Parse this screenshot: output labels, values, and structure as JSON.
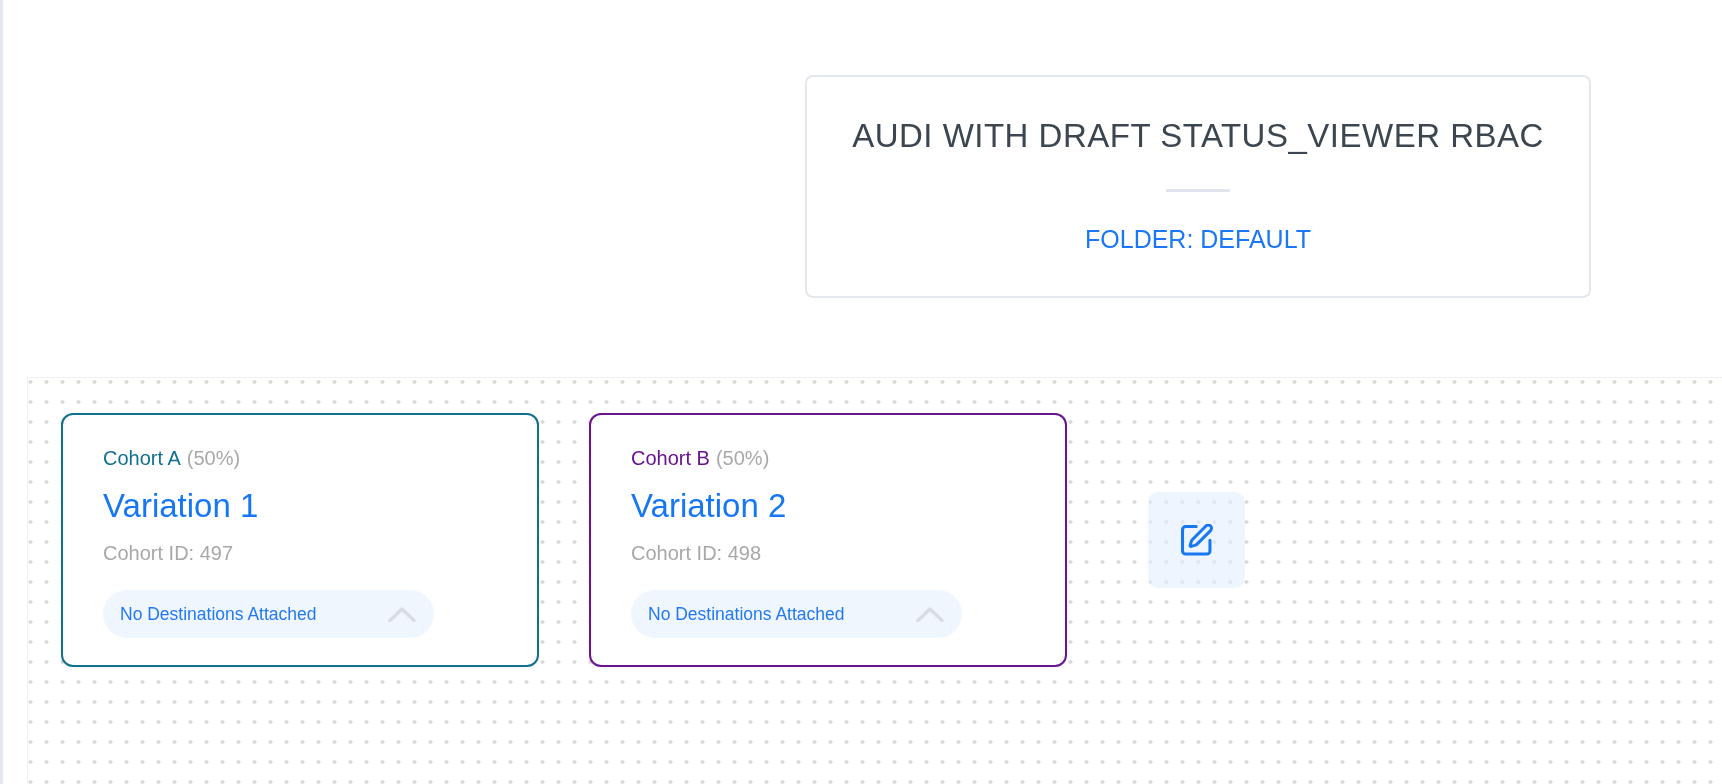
{
  "header": {
    "title": "AUDI WITH DRAFT STATUS_VIEWER RBAC",
    "folder": "FOLDER: DEFAULT"
  },
  "cohorts": [
    {
      "name": "Cohort A",
      "share": "(50%)",
      "color": "#11708d",
      "variation": "Variation 1",
      "cohort_id": "Cohort ID: 497",
      "destinations": "No Destinations Attached"
    },
    {
      "name": "Cohort B",
      "share": "(50%)",
      "color": "#6a1490",
      "variation": "Variation 2",
      "cohort_id": "Cohort ID: 498",
      "destinations": "No Destinations Attached"
    }
  ]
}
